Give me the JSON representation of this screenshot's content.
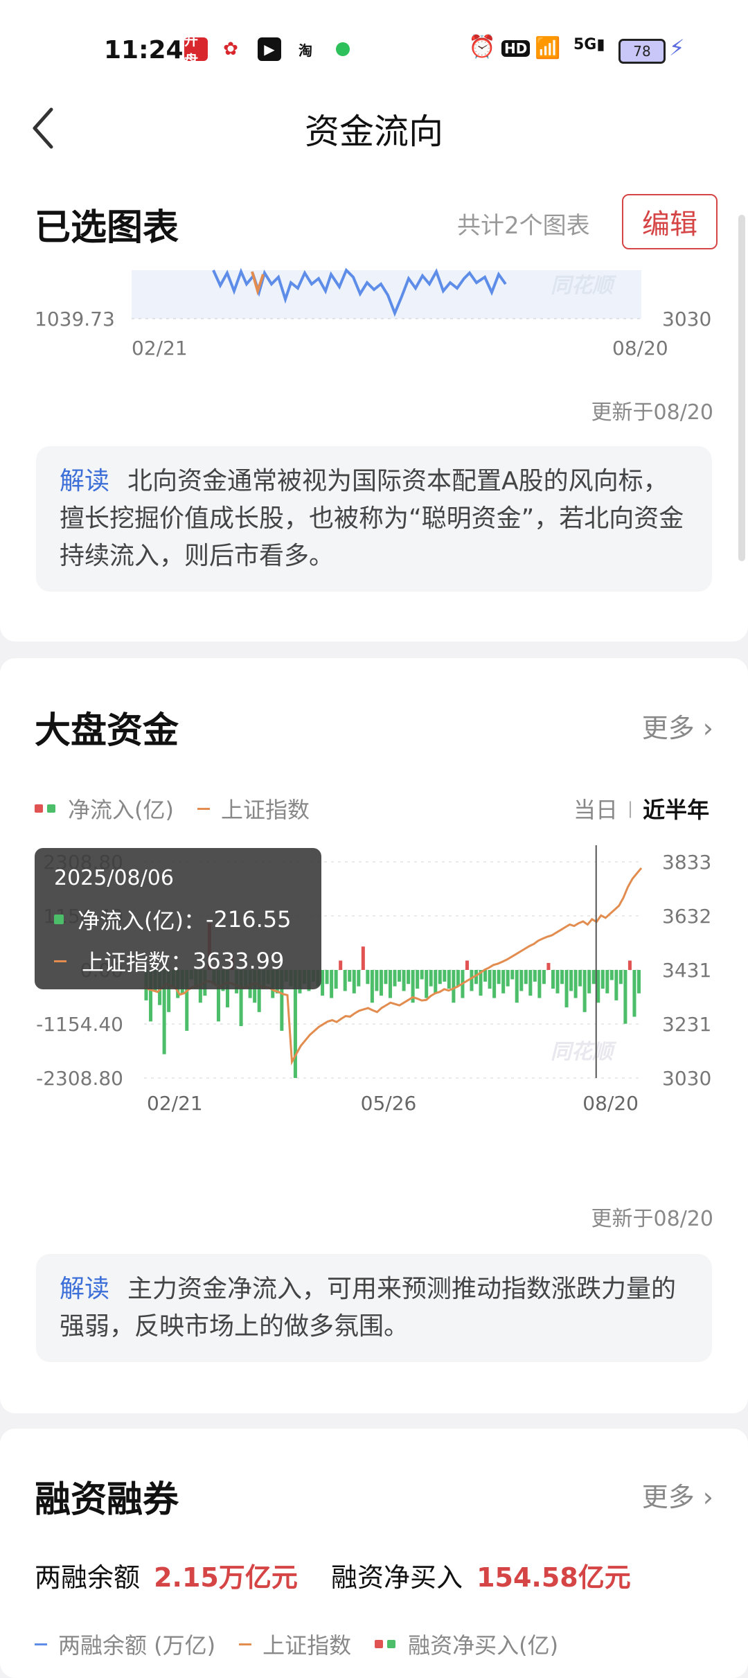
{
  "status": {
    "time": "11:24",
    "apps": [
      "开盘",
      "淘"
    ],
    "battery": "78"
  },
  "nav": {
    "title": "资金流向"
  },
  "selected": {
    "title": "已选图表",
    "count": "共计2个图表",
    "edit": "编辑",
    "y_left_bottom": "1039.73",
    "y_right_bottom": "3030",
    "x_start": "02/21",
    "x_end": "08/20",
    "watermark": "同花顺",
    "updated": "更新于08/20",
    "interp_tag": "解读",
    "interp_text": "北向资金通常被视为国际资本配置A股的风向标，擅长挖掘价值成长股，也被称为“聪明资金”，若北向资金持续流入，则后市看多。"
  },
  "market": {
    "title": "大盘资金",
    "more": "更多",
    "legend_net": "净流入(亿)",
    "legend_index": "上证指数",
    "range_day": "当日",
    "range_half": "近半年",
    "updated": "更新于08/20",
    "interp_tag": "解读",
    "interp_text": "主力资金净流入，可用来预测推动指数涨跌力量的强弱，反映市场上的做多氛围。",
    "tooltip": {
      "date": "2025/08/06",
      "net_label": "净流入(亿)：",
      "net_value": "-216.55",
      "index_label": "上证指数：",
      "index_value": "3633.99"
    },
    "watermark": "同花顺",
    "colors": {
      "up": "#e15252",
      "down": "#4cbe6a",
      "index_line": "#e28d4f"
    }
  },
  "chart_data": {
    "type": "bar",
    "title": "",
    "y_left_ticks": [
      "2308.80",
      "1154.40",
      "0.00",
      "-1154.40",
      "-2308.80"
    ],
    "y_right_ticks": [
      "3833",
      "3632",
      "3431",
      "3231",
      "3030"
    ],
    "x_ticks": [
      "02/21",
      "05/26",
      "08/20"
    ],
    "ylim": [
      -2308.8,
      2308.8
    ],
    "ylim_right": [
      3030,
      3833
    ],
    "series": [
      {
        "name": "净流入(亿)",
        "values": [
          -650,
          -1100,
          -450,
          -750,
          -1800,
          -900,
          -350,
          -600,
          -500,
          -1300,
          -200,
          -400,
          -700,
          -550,
          1000,
          -300,
          -1100,
          -450,
          -800,
          300,
          -500,
          -1200,
          -350,
          -600,
          -700,
          -900,
          -400,
          -300,
          -600,
          -500,
          -1300,
          -250,
          -350,
          -2308,
          -500,
          -300,
          -450,
          -250,
          -350,
          -550,
          -300,
          -600,
          -400,
          200,
          -450,
          -250,
          -500,
          -350,
          500,
          -300,
          -700,
          -450,
          -550,
          -300,
          -600,
          -350,
          -250,
          -450,
          -300,
          -700,
          -400,
          -200,
          -600,
          -350,
          -500,
          -300,
          -250,
          -400,
          -700,
          -350,
          -600,
          200,
          -450,
          -300,
          -550,
          -250,
          -400,
          -600,
          -300,
          -500,
          -350,
          -200,
          -700,
          -450,
          -300,
          -550,
          -250,
          -600,
          -300,
          150,
          -400,
          -500,
          -300,
          -800,
          -450,
          -600,
          -350,
          -900,
          -500,
          -300,
          -700,
          -400,
          -500,
          -216,
          -650,
          -300,
          -1150,
          200,
          -1000,
          -500
        ]
      },
      {
        "name": "上证指数",
        "values": [
          3370,
          3360,
          3355,
          3350,
          3365,
          3380,
          3372,
          3365,
          3340,
          3345,
          3360,
          3368,
          3372,
          3380,
          3390,
          3388,
          3375,
          3370,
          3380,
          3385,
          3378,
          3372,
          3365,
          3368,
          3378,
          3382,
          3370,
          3368,
          3365,
          3355,
          3350,
          3342,
          3338,
          3090,
          3120,
          3150,
          3170,
          3190,
          3205,
          3220,
          3230,
          3240,
          3245,
          3238,
          3250,
          3260,
          3258,
          3270,
          3280,
          3285,
          3290,
          3282,
          3275,
          3290,
          3300,
          3310,
          3305,
          3300,
          3310,
          3320,
          3330,
          3325,
          3318,
          3320,
          3335,
          3345,
          3350,
          3360,
          3355,
          3362,
          3370,
          3380,
          3390,
          3400,
          3410,
          3420,
          3432,
          3440,
          3450,
          3455,
          3462,
          3470,
          3480,
          3490,
          3500,
          3510,
          3520,
          3528,
          3540,
          3548,
          3555,
          3560,
          3570,
          3580,
          3590,
          3600,
          3595,
          3605,
          3612,
          3600,
          3620,
          3610,
          3634,
          3625,
          3640,
          3655,
          3670,
          3700,
          3740,
          3770,
          3790,
          3810
        ]
      }
    ]
  },
  "margin": {
    "title": "融资融券",
    "more": "更多",
    "balance_label": "两融余额",
    "balance_value": "2.15万亿元",
    "net_buy_label": "融资净买入",
    "net_buy_value": "154.58亿元",
    "legend_balance": "两融余额 (万亿)",
    "legend_index": "上证指数",
    "legend_net": "融资净买入(亿)"
  }
}
